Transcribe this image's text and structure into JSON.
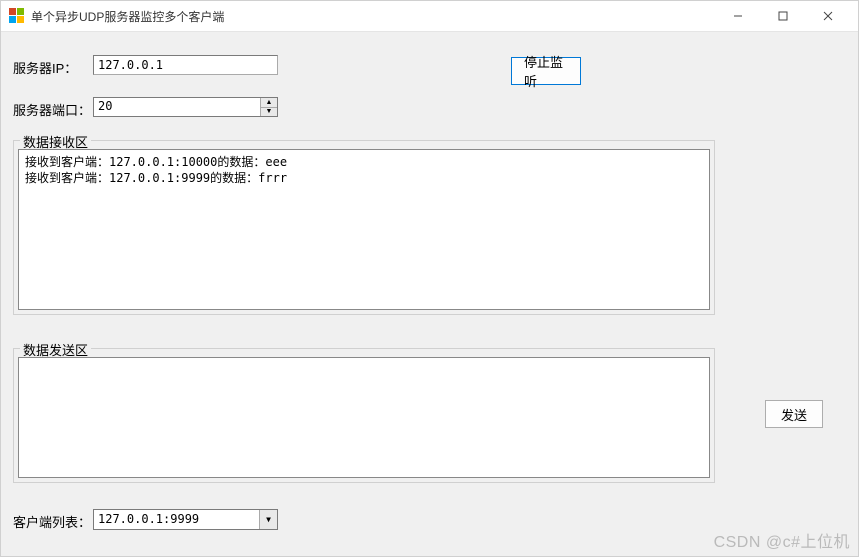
{
  "window": {
    "title": "单个异步UDP服务器监控多个客户端"
  },
  "labels": {
    "server_ip": "服务器IP：",
    "server_port": "服务器端口：",
    "recv_group": "数据接收区",
    "send_group": "数据发送区",
    "client_list": "客户端列表："
  },
  "inputs": {
    "server_ip_value": "127.0.0.1",
    "server_port_value": "20",
    "send_text": "",
    "client_selected": "127.0.0.1:9999"
  },
  "buttons": {
    "stop_listen": "停止监听",
    "send": "发送"
  },
  "receive_log": [
    "接收到客户端：127.0.0.1:10000的数据：eee",
    "接收到客户端：127.0.0.1:9999的数据：frrr"
  ],
  "watermark": "CSDN @c#上位机"
}
